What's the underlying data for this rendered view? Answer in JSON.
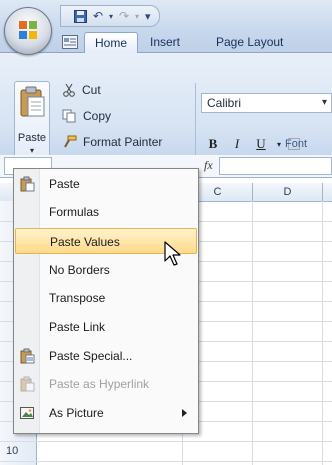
{
  "ribbon": {
    "tabs": [
      {
        "label": "Home",
        "active": true
      },
      {
        "label": "Insert",
        "active": false
      },
      {
        "label": "Page Layout",
        "active": false
      }
    ],
    "clipboard": {
      "paste_label": "Paste",
      "cut_label": "Cut",
      "copy_label": "Copy",
      "format_painter_label": "Format Painter"
    },
    "font": {
      "font_name": "Calibri",
      "bold": "B",
      "italic": "I",
      "underline": "U",
      "group_label": "Font"
    }
  },
  "formula_bar": {
    "fx_label": "fx"
  },
  "grid": {
    "columns": [
      "C",
      "D"
    ],
    "visible_row_number": "10"
  },
  "paste_menu": {
    "items": [
      {
        "label": "Paste",
        "icon": "paste-icon",
        "enabled": true
      },
      {
        "label": "Formulas",
        "icon": "",
        "enabled": true
      },
      {
        "label": "Paste Values",
        "icon": "",
        "enabled": true,
        "highlighted": true
      },
      {
        "label": "No Borders",
        "icon": "",
        "enabled": true
      },
      {
        "label": "Transpose",
        "icon": "",
        "enabled": true
      },
      {
        "label": "Paste Link",
        "icon": "",
        "enabled": true
      },
      {
        "label": "Paste Special...",
        "icon": "paste-special-icon",
        "enabled": true
      },
      {
        "label": "Paste as Hyperlink",
        "icon": "paste-hyperlink-icon",
        "enabled": false
      },
      {
        "label": "As Picture",
        "icon": "picture-icon",
        "enabled": true,
        "submenu": true
      }
    ]
  },
  "colors": {
    "ribbon_bg": "#d8e4f3",
    "menu_highlight": "#ffd98a",
    "disabled_text": "#a0a0a0"
  }
}
